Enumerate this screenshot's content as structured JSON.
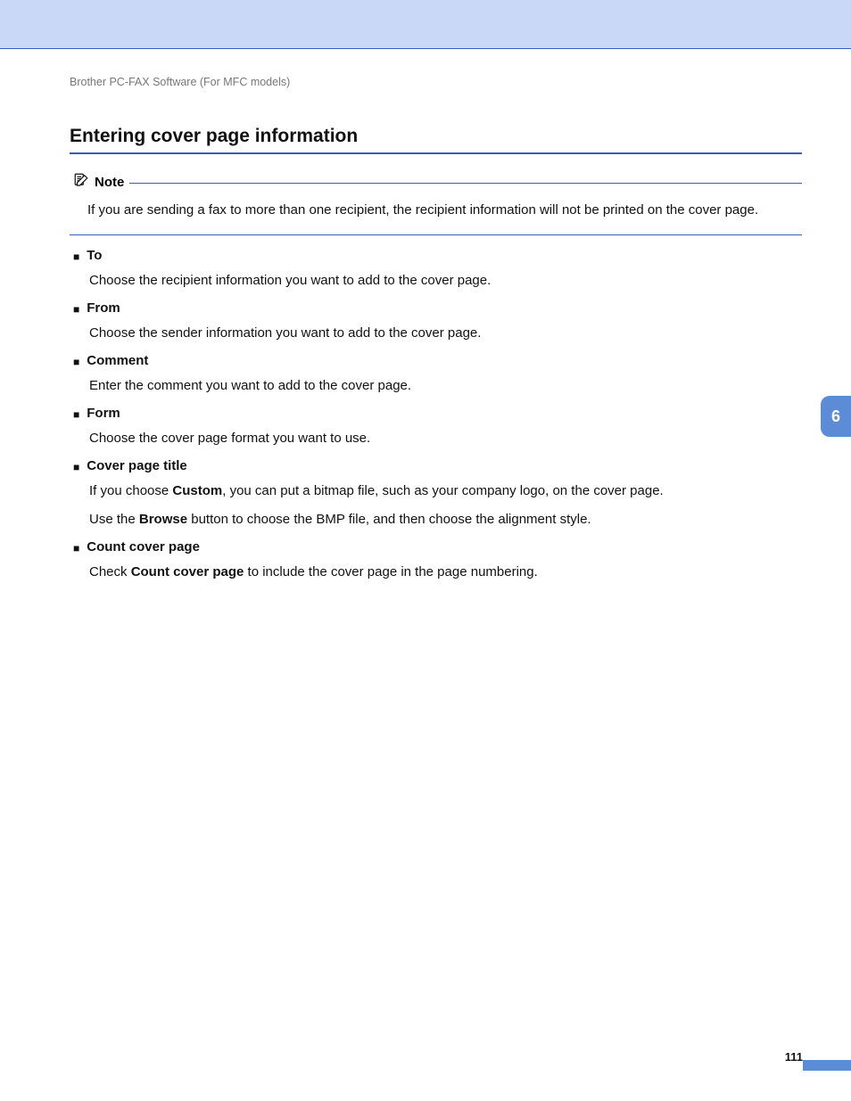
{
  "header": {
    "breadcrumb": "Brother PC-FAX Software (For MFC models)"
  },
  "section": {
    "title": "Entering cover page information"
  },
  "note": {
    "label": "Note",
    "text": "If you are sending a fax to more than one recipient, the recipient information will not be printed on the cover page."
  },
  "items": [
    {
      "title": "To",
      "body": "Choose the recipient information you want to add to the cover page."
    },
    {
      "title": "From",
      "body": "Choose the sender information you want to add to the cover page."
    },
    {
      "title": "Comment",
      "body": "Enter the comment you want to add to the cover page."
    },
    {
      "title": "Form",
      "body": "Choose the cover page format you want to use."
    }
  ],
  "cover_page_title": {
    "title": "Cover page title",
    "line1_pre": "If you choose ",
    "line1_bold": "Custom",
    "line1_post": ", you can put a bitmap file, such as your company logo, on the cover page.",
    "line2_pre": "Use the ",
    "line2_bold": "Browse",
    "line2_post": " button to choose the BMP file, and then choose the alignment style."
  },
  "count_cover_page": {
    "title": "Count cover page",
    "pre": "Check ",
    "bold": "Count cover page",
    "post": " to include the cover page in the page numbering."
  },
  "chapter": "6",
  "page_number": "111"
}
